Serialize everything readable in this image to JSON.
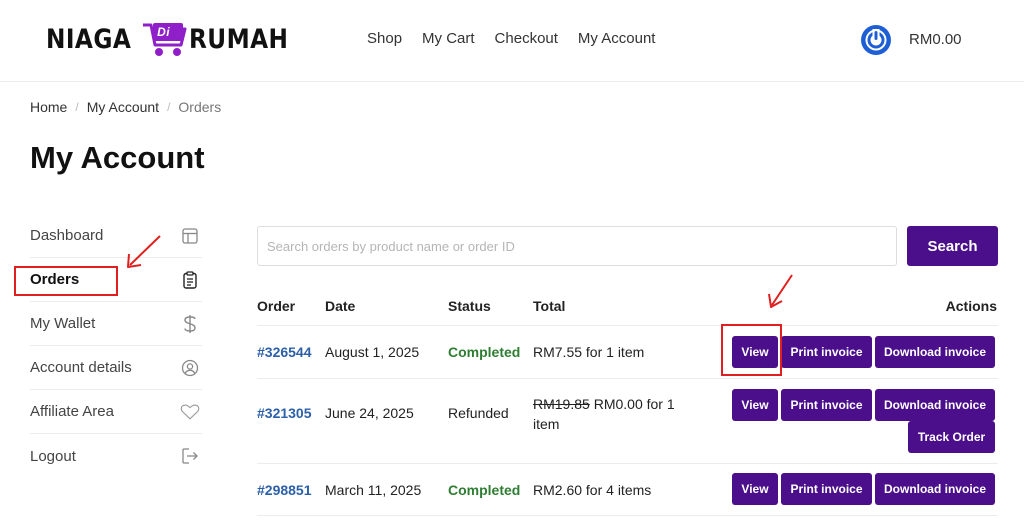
{
  "header": {
    "logo": {
      "part1": "NIAGA",
      "badge": "Di",
      "part2": "RUMAH"
    },
    "nav": [
      "Shop",
      "My Cart",
      "Checkout",
      "My Account"
    ],
    "cart_total": "RM0.00"
  },
  "breadcrumb": {
    "home": "Home",
    "parent": "My Account",
    "current": "Orders",
    "sep": "/"
  },
  "page_title": "My Account",
  "sidebar": {
    "items": [
      {
        "label": "Dashboard",
        "icon": "layout-icon"
      },
      {
        "label": "Orders",
        "icon": "clipboard-icon"
      },
      {
        "label": "My Wallet",
        "icon": "dollar-icon"
      },
      {
        "label": "Account details",
        "icon": "user-circle-icon"
      },
      {
        "label": "Affiliate Area",
        "icon": "heart-icon"
      },
      {
        "label": "Logout",
        "icon": "logout-icon"
      }
    ],
    "active": "Orders"
  },
  "search": {
    "placeholder": "Search orders by product name or order ID",
    "value": "",
    "button": "Search"
  },
  "orders": {
    "headers": {
      "order": "Order",
      "date": "Date",
      "status": "Status",
      "total": "Total",
      "actions": "Actions"
    },
    "rows": [
      {
        "id": "#326544",
        "date": "August 1, 2025",
        "status": "Completed",
        "total_old": "",
        "total": "RM7.55 for 1 item",
        "actions": {
          "view": "View",
          "print": "Print invoice",
          "download": "Download invoice"
        }
      },
      {
        "id": "#321305",
        "date": "June 24, 2025",
        "status": "Refunded",
        "total_old": "RM19.85",
        "total": "RM0.00 for 1 item",
        "actions": {
          "view": "View",
          "print": "Print invoice",
          "download": "Download invoice",
          "track": "Track Order"
        }
      },
      {
        "id": "#298851",
        "date": "March 11, 2025",
        "status": "Completed",
        "total_old": "",
        "total": "RM2.60 for 4 items",
        "actions": {
          "view": "View",
          "print": "Print invoice",
          "download": "Download invoice"
        }
      }
    ]
  },
  "colors": {
    "brand_purple": "#4b0f8c",
    "link_blue": "#2b5fa8",
    "completed_green": "#2f7d32",
    "annotation_red": "#e02020",
    "user_icon_blue": "#1e5fd6"
  }
}
